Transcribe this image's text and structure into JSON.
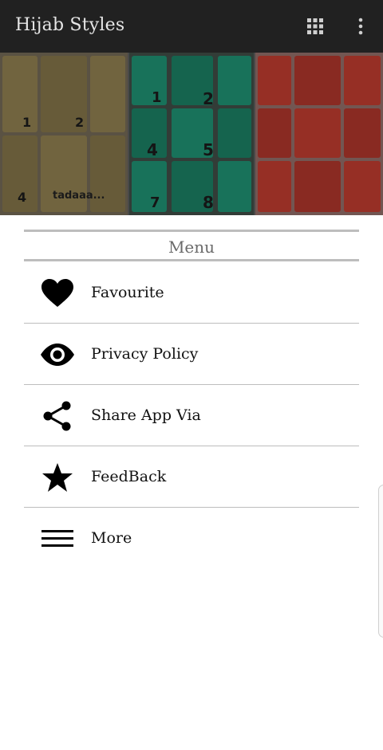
{
  "app": {
    "title": "Hijab Styles"
  },
  "toolbar": {
    "grid_icon": "apps-grid-icon",
    "overflow_icon": "more-vert-icon"
  },
  "banner": {
    "panels": [
      {
        "color": "#8a7a4e",
        "labels": [
          "1",
          "2",
          "4",
          "tadaaa..."
        ]
      },
      {
        "color": "#1e8c6e",
        "labels": [
          "1",
          "2",
          "4",
          "5",
          "7",
          "8"
        ]
      },
      {
        "color": "#b83a2e",
        "labels": []
      }
    ]
  },
  "menu": {
    "title": "Menu",
    "items": [
      {
        "label": "Favourite",
        "icon": "heart-icon"
      },
      {
        "label": "Privacy Policy",
        "icon": "eye-icon"
      },
      {
        "label": "Share App Via",
        "icon": "share-icon"
      },
      {
        "label": "FeedBack",
        "icon": "star-icon"
      },
      {
        "label": "More",
        "icon": "menu-lines-icon"
      }
    ]
  },
  "colors": {
    "appbar": "#212121",
    "divider": "#bdbdbd",
    "text": "#111111"
  }
}
